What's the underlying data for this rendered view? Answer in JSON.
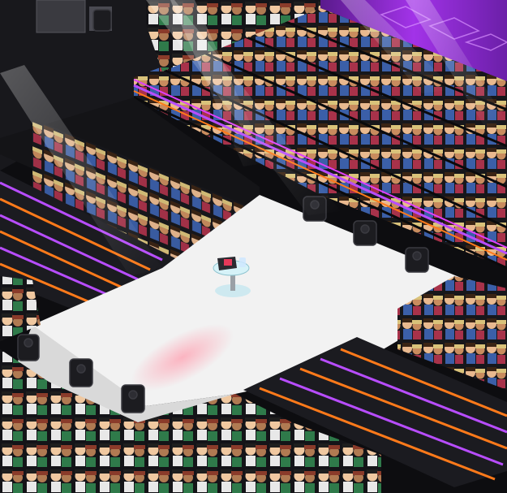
{
  "scene": {
    "title": "",
    "colors": {
      "background": "#0d0d10",
      "runway_floor": "#f2f2f2",
      "runway_edge": "#2a2a2e",
      "stage_black": "#141417",
      "neon_purple": "#b84dff",
      "neon_magenta": "#e040fb",
      "neon_orange": "#ff7a1a",
      "screen_purple": "#8e2bd6",
      "spotlight": "#ffffff"
    },
    "objects": [
      {
        "name": "runway-floor",
        "label": "Runway"
      },
      {
        "name": "moving-head-light",
        "count": 7
      },
      {
        "name": "podium-table-with-laptop",
        "label": "Podium"
      },
      {
        "name": "audience-left-bleachers"
      },
      {
        "name": "audience-right-bleachers"
      },
      {
        "name": "audience-front-crowd"
      },
      {
        "name": "front-row-seated-guests"
      },
      {
        "name": "neon-stripe-panel-left"
      },
      {
        "name": "neon-stripe-panel-right"
      },
      {
        "name": "led-screen-top-right"
      }
    ]
  }
}
